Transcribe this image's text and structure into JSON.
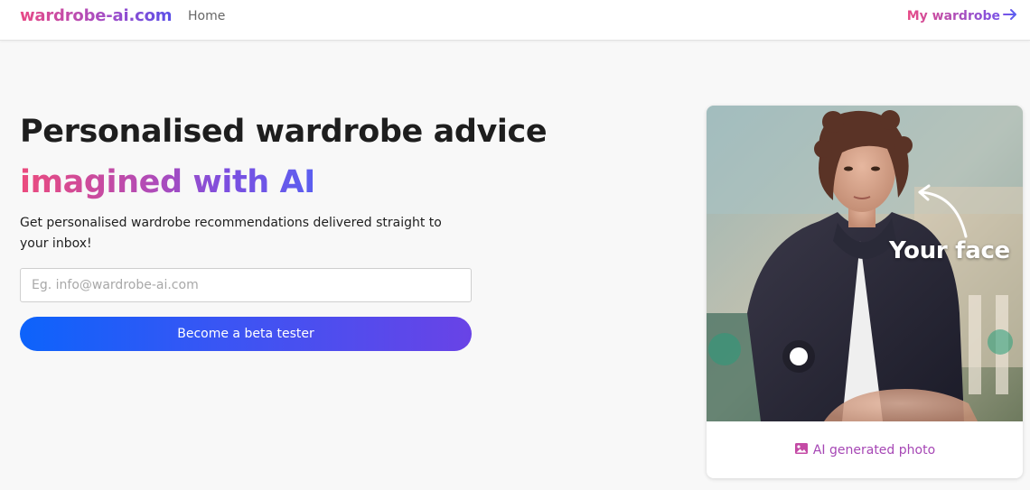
{
  "navbar": {
    "brand": "wardrobe-ai.com",
    "home_label": "Home",
    "wardrobe_label": "My wardrobe",
    "wardrobe_arrow": "→"
  },
  "hero": {
    "title": "Personalised wardrobe advice",
    "subtitle": "imagined with AI",
    "description": "Get personalised wardrobe recommendations delivered straight to your inbox!",
    "email_placeholder": "Eg. info@wardrobe-ai.com",
    "email_value": "",
    "cta_label": "Become a beta tester"
  },
  "photo_card": {
    "overlay_label": "Your face",
    "caption": "AI generated photo",
    "caption_icon": "image-icon"
  },
  "colors": {
    "brand_pink": "#e84a86",
    "brand_purple": "#7a52e6",
    "button_blue": "#0d63fb",
    "button_purple": "#6943e6",
    "caption_purple": "#a647b5",
    "background": "#f8f8f8"
  }
}
